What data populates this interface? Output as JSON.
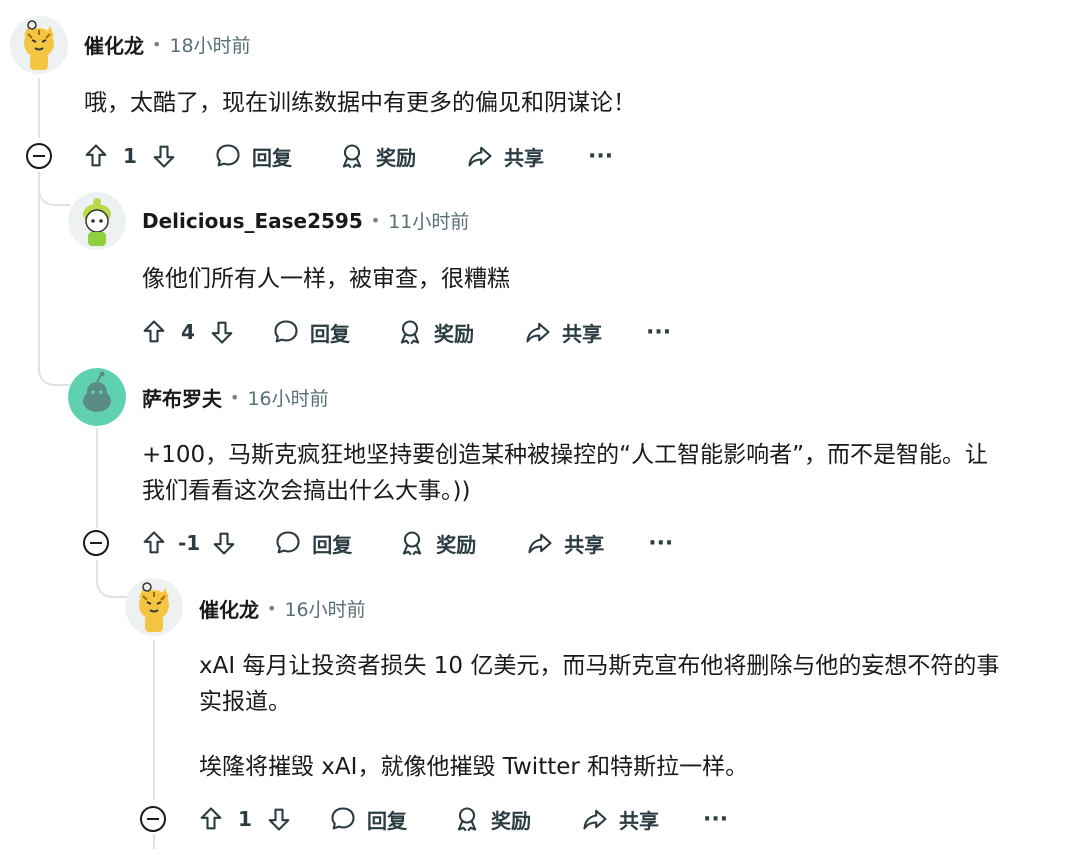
{
  "labels": {
    "reply": "回复",
    "award": "奖励",
    "share": "共享",
    "more": "···"
  },
  "comments": [
    {
      "author": "催化龙",
      "dot": "•",
      "time": "18小时前",
      "text": "哦，太酷了，现在训练数据中有更多的偏见和阴谋论！",
      "score": "1"
    },
    {
      "author": "Delicious_Ease2595",
      "dot": "•",
      "time": "11小时前",
      "text": "像他们所有人一样，被审查，很糟糕",
      "score": "4"
    },
    {
      "author": "萨布罗夫",
      "dot": "•",
      "time": "16小时前",
      "text_line1": "+100，马斯克疯狂地坚持要创造某种被操控的“人工智能影响者”，而不是智能。让",
      "text_line2": "我们看看这次会搞出什么大事。))",
      "score": "-1"
    },
    {
      "author": "催化龙",
      "dot": "•",
      "time": "16小时前",
      "text_line1": "xAI 每月让投资者损失 10 亿美元，而马斯克宣布他将删除与他的妄想不符的事",
      "text_line2": "实报道。",
      "text_line3": "埃隆将摧毁 xAI，就像他摧毁 Twitter 和特斯拉一样。",
      "score": "1"
    }
  ]
}
